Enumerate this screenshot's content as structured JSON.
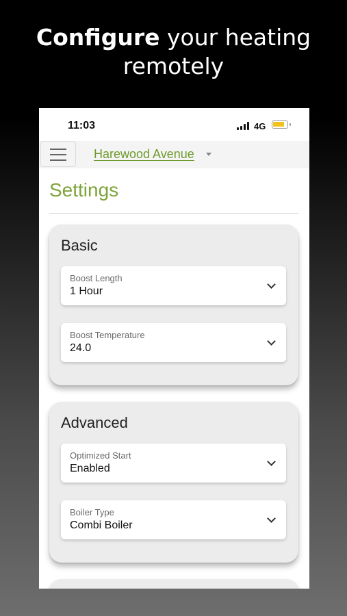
{
  "hero": {
    "bold": "Configure",
    "rest": " your heating remotely"
  },
  "status_bar": {
    "time": "11:03",
    "network": "4G",
    "icons": [
      "signal-icon",
      "battery-icon"
    ]
  },
  "navbar": {
    "location": "Harewood Avenue",
    "icons": [
      "hamburger-menu-icon",
      "caret-down-icon"
    ]
  },
  "page": {
    "title": "Settings"
  },
  "sections": [
    {
      "title": "Basic",
      "fields": [
        {
          "label": "Boost Length",
          "value": "1 Hour"
        },
        {
          "label": "Boost Temperature",
          "value": "24.0"
        }
      ]
    },
    {
      "title": "Advanced",
      "fields": [
        {
          "label": "Optimized Start",
          "value": "Enabled"
        },
        {
          "label": "Boiler Type",
          "value": "Combi Boiler"
        }
      ]
    }
  ],
  "colors": {
    "accent_green": "#7ea43b",
    "link_green": "#6f9a2c",
    "battery": "#f1c21b"
  }
}
